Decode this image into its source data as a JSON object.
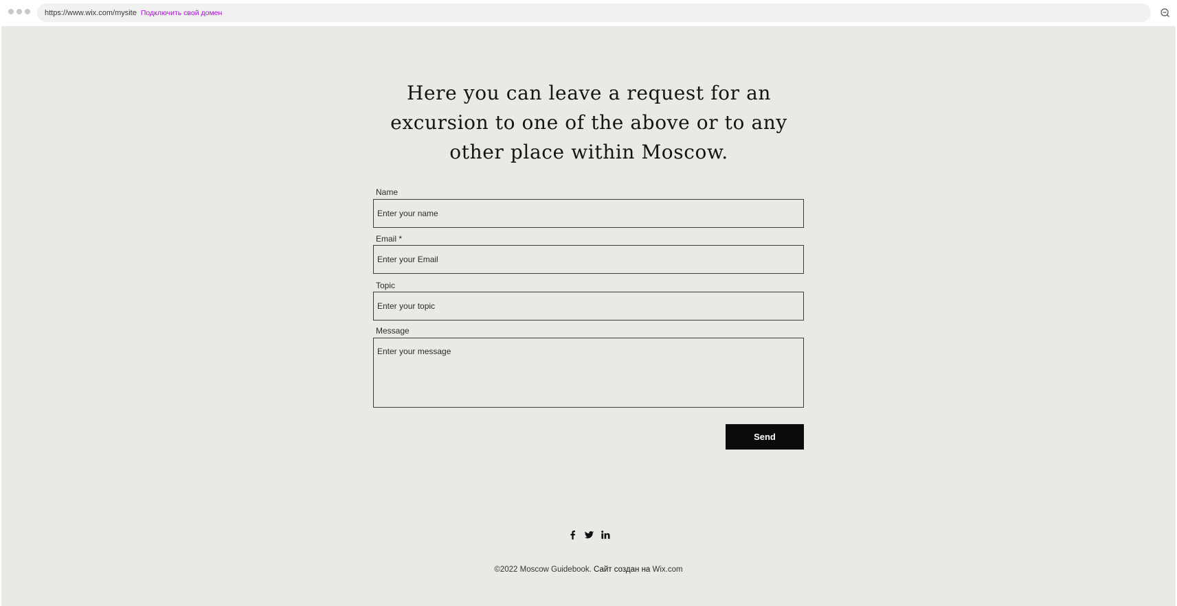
{
  "browser": {
    "url": "https://www.wix.com/mysite",
    "connect_domain_link": "Подключить свой домен",
    "zoom_icon": "zoom-out-icon"
  },
  "contact": {
    "heading": "Here you can leave a request for an excursion to one of the above or to any other place within Moscow.",
    "fields": [
      {
        "label": "Name",
        "placeholder": "Enter your name",
        "value": ""
      },
      {
        "label": "Email *",
        "placeholder": "Enter your Email",
        "value": ""
      },
      {
        "label": "Topic",
        "placeholder": "Enter your topic",
        "value": ""
      },
      {
        "label": "Message",
        "placeholder": "Enter your message",
        "value": ""
      }
    ],
    "send_label": "Send"
  },
  "social": {
    "icons": [
      "facebook-icon",
      "twitter-icon",
      "linkedin-icon"
    ]
  },
  "footer": {
    "copyright": "©2022 Moscow Guidebook.",
    "made_with": " Сайт создан на ",
    "platform": "Wix.com"
  },
  "colors": {
    "page_background": "#ebe9e5",
    "button_background": "#0b0b0b",
    "link_accent": "#a40fd0"
  }
}
